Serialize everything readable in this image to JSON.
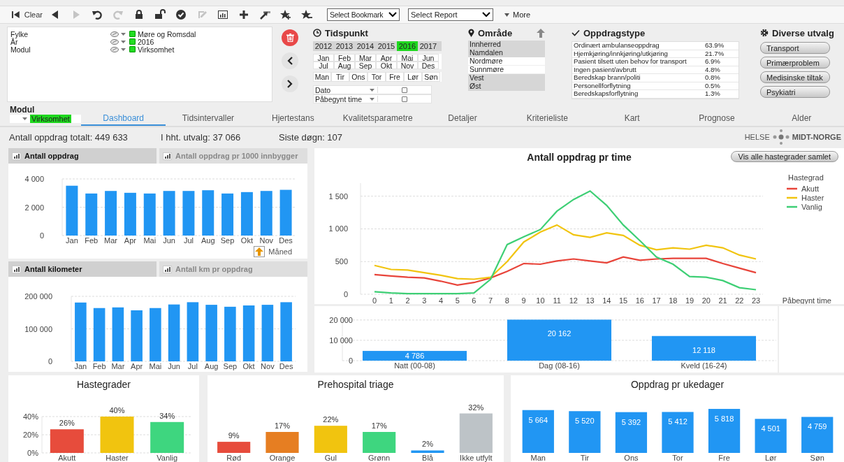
{
  "toolbar": {
    "items": [
      {
        "kind": "clear",
        "label": "Clear",
        "disabled": false
      },
      {
        "kind": "back",
        "disabled": false
      },
      {
        "kind": "forward",
        "disabled": true
      },
      {
        "kind": "undo",
        "disabled": false
      },
      {
        "kind": "redo",
        "disabled": true
      },
      {
        "kind": "lock",
        "disabled": false
      },
      {
        "kind": "unlock",
        "disabled": false
      },
      {
        "kind": "check",
        "disabled": false
      },
      {
        "kind": "edit",
        "disabled": true
      },
      {
        "kind": "chart",
        "disabled": false
      },
      {
        "kind": "add",
        "disabled": false
      },
      {
        "kind": "arrow",
        "disabled": false
      },
      {
        "kind": "star-add",
        "disabled": false
      },
      {
        "kind": "star-remove",
        "disabled": false
      }
    ],
    "bookmark_select": "Select Bookmark",
    "report_select": "Select Report",
    "more": "More"
  },
  "current_selections": [
    {
      "field": "Fylke",
      "value": "Møre og Romsdal",
      "selected": true
    },
    {
      "field": "År",
      "value": "2016",
      "selected": true
    },
    {
      "field": "Modul",
      "value": "Virksomhet",
      "selected": true
    }
  ],
  "tidspunkt": {
    "title": "Tidspunkt",
    "years": [
      {
        "label": "2012",
        "selected": false
      },
      {
        "label": "2013",
        "selected": false
      },
      {
        "label": "2014",
        "selected": false
      },
      {
        "label": "2015",
        "selected": false
      },
      {
        "label": "2016",
        "selected": true
      },
      {
        "label": "2017",
        "selected": false
      }
    ],
    "months": [
      {
        "label": "Jan",
        "selected": false
      },
      {
        "label": "Feb",
        "selected": false
      },
      {
        "label": "Mar",
        "selected": false
      },
      {
        "label": "Apr",
        "selected": false
      },
      {
        "label": "Mai",
        "selected": false
      },
      {
        "label": "Jun",
        "selected": false
      },
      {
        "label": "Jul",
        "selected": false
      },
      {
        "label": "Aug",
        "selected": false
      },
      {
        "label": "Sep",
        "selected": false
      },
      {
        "label": "Okt",
        "selected": false
      },
      {
        "label": "Nov",
        "selected": false
      },
      {
        "label": "Des",
        "selected": false
      }
    ],
    "weekdays": [
      {
        "label": "Man",
        "selected": false
      },
      {
        "label": "Tir",
        "selected": false
      },
      {
        "label": "Ons",
        "selected": false
      },
      {
        "label": "Tor",
        "selected": false
      },
      {
        "label": "Fre",
        "selected": false
      },
      {
        "label": "Lør",
        "selected": false
      },
      {
        "label": "Søn",
        "selected": false
      }
    ],
    "filters": [
      {
        "label": "Dato",
        "checked": false
      },
      {
        "label": "Påbegynt time",
        "checked": false
      }
    ]
  },
  "omrade": {
    "title": "Område",
    "items": [
      {
        "label": "Innherred",
        "excluded": true
      },
      {
        "label": "Namdalen",
        "excluded": true
      },
      {
        "label": "Nordmøre",
        "excluded": false
      },
      {
        "label": "Sunnmøre",
        "excluded": false
      },
      {
        "label": "Vest",
        "excluded": true
      },
      {
        "label": "Øst",
        "excluded": true
      }
    ]
  },
  "oppdragstype": {
    "title": "Oppdragstype",
    "rows": [
      {
        "label": "Ordinært ambulanseoppdrag",
        "share": "63.9%"
      },
      {
        "label": "Hjemkjøring/innkjøring/utkjøring",
        "share": "21.7%"
      },
      {
        "label": "Pasient tilsett uten behov for transport",
        "share": "6.9%"
      },
      {
        "label": "Ingen pasient/avbrutt",
        "share": "4.8%"
      },
      {
        "label": "Beredskap brann/politi",
        "share": "0.8%"
      },
      {
        "label": "Personellforflytning",
        "share": "0.5%"
      },
      {
        "label": "Beredskapsforflytning",
        "share": "1.3%"
      }
    ]
  },
  "diverse": {
    "title": "Diverse utvalg",
    "buttons": [
      "Transport",
      "Primærproblem",
      "Medisinske tiltak",
      "Psykiatri"
    ]
  },
  "modul": {
    "label": "Modul",
    "value": "Virksomhet",
    "selected": true
  },
  "tabs": [
    {
      "label": "Dashboard",
      "selected": true
    },
    {
      "label": "Tidsintervaller",
      "selected": false
    },
    {
      "label": "Hjertestans",
      "selected": false
    },
    {
      "label": "Kvalitetsparametre",
      "selected": false
    },
    {
      "label": "Detaljer",
      "selected": false
    },
    {
      "label": "Kriterieliste",
      "selected": false
    },
    {
      "label": "Kart",
      "selected": false
    },
    {
      "label": "Prognose",
      "selected": false
    },
    {
      "label": "Alder",
      "selected": false
    }
  ],
  "stats": [
    "Antall oppdrag totalt: 449 633",
    "I hht. utvalg: 37 066",
    "Siste døgn: 107"
  ],
  "logo": {
    "left": "HELSE",
    "right": "MIDT-NORGE"
  },
  "left_panels": [
    {
      "tabs": [
        {
          "label": "Antall oppdrag",
          "selected": true
        },
        {
          "label": "Antall oppdrag pr 1000 innbygger",
          "selected": false
        }
      ],
      "axis_button": "Måned",
      "chart_data": {
        "type": "bar",
        "grid": true,
        "categories": [
          "Jan",
          "Feb",
          "Mar",
          "Apr",
          "Mai",
          "Jun",
          "Jul",
          "Aug",
          "Sep",
          "Okt",
          "Nov",
          "Des"
        ],
        "series": [
          {
            "color": "#2196f3",
            "values": [
              3520,
              2970,
              3150,
              3020,
              2970,
              3150,
              3150,
              3200,
              2970,
              3070,
              3150,
              3230
            ]
          }
        ],
        "ylim": [
          0,
          4000
        ],
        "yticks": [
          0,
          {
            "value": 2000,
            "label": "2 000"
          },
          {
            "value": 4000,
            "label": "4 000"
          }
        ]
      }
    },
    {
      "tabs": [
        {
          "label": "Antall kilometer",
          "selected": true
        },
        {
          "label": "Antall km pr oppdrag",
          "selected": false
        }
      ],
      "chart_data": {
        "type": "bar",
        "grid": true,
        "categories": [
          "Jan",
          "Feb",
          "Mar",
          "Apr",
          "Mai",
          "Jun",
          "Jul",
          "Aug",
          "Sep",
          "Okt",
          "Nov",
          "Des"
        ],
        "series": [
          {
            "color": "#2196f3",
            "values": [
              181000,
              164000,
              166000,
              157000,
              164000,
              175000,
              182000,
              174000,
              168000,
              172000,
              174000,
              182000
            ]
          }
        ],
        "ylim": [
          0,
          200000
        ],
        "yticks": [
          0,
          {
            "value": 100000,
            "label": "100 000"
          },
          {
            "value": 200000,
            "label": "200 000"
          }
        ]
      }
    }
  ],
  "hourly": {
    "button": "Vis alle hastegrader samlet",
    "legend_title": "Hastegrad",
    "chart_data": {
      "type": "line",
      "grid": true,
      "legend": "right",
      "ylim": [
        0,
        1700
      ],
      "title": "Antall oppdrag pr time",
      "xlabel": "Påbegynt time",
      "x": [
        0,
        1,
        2,
        3,
        4,
        5,
        6,
        7,
        8,
        9,
        10,
        11,
        12,
        13,
        14,
        15,
        16,
        17,
        18,
        19,
        20,
        21,
        22,
        23
      ],
      "yticks": [
        0,
        500,
        {
          "value": 1000,
          "label": "1 000"
        },
        {
          "value": 1500,
          "label": "1 500"
        }
      ],
      "series": [
        {
          "name": "Akutt",
          "color": "#e8443a",
          "values": [
            300,
            280,
            260,
            250,
            200,
            140,
            180,
            250,
            350,
            470,
            460,
            510,
            540,
            510,
            480,
            570,
            520,
            540,
            550,
            550,
            550,
            470,
            400,
            330
          ]
        },
        {
          "name": "Haster",
          "color": "#f1c40f",
          "values": [
            440,
            380,
            370,
            330,
            290,
            240,
            230,
            260,
            500,
            800,
            950,
            1060,
            910,
            870,
            940,
            900,
            750,
            680,
            710,
            690,
            750,
            710,
            600,
            540
          ]
        },
        {
          "name": "Vanlig",
          "color": "#3ecf75",
          "values": [
            40,
            20,
            10,
            10,
            10,
            10,
            20,
            230,
            760,
            880,
            990,
            1270,
            1450,
            1580,
            1360,
            1060,
            820,
            570,
            460,
            270,
            260,
            210,
            100,
            70
          ]
        }
      ]
    }
  },
  "shifts": {
    "chart_data": {
      "type": "bar",
      "grid": true,
      "ylim": [
        0,
        22000
      ],
      "categories": [
        "Natt (00-08)",
        "Dag (08-16)",
        "Kveld (16-24)"
      ],
      "series": [
        {
          "color": "#2196f3",
          "values": [
            4786,
            20162,
            12118
          ]
        }
      ],
      "yticks": [
        0,
        {
          "value": 10000,
          "label": "10 000"
        },
        {
          "value": 20000,
          "label": "20 000"
        }
      ],
      "value_labels": [
        "4 786",
        "20 162",
        "12 118"
      ]
    }
  },
  "bottom_panels": [
    {
      "chart_data": {
        "type": "bar",
        "grid": true,
        "ylim": [
          0,
          40
        ],
        "title": "Hastegrader",
        "categories": [
          "Akutt",
          "Haster",
          "Vanlig"
        ],
        "values": [
          26,
          40,
          34
        ],
        "colors": [
          "#e74c3c",
          "#f1c40f",
          "#3ed67f"
        ],
        "yticks": [
          {
            "value": 0,
            "label": "0%"
          },
          {
            "value": 20,
            "label": "20%"
          },
          {
            "value": 40,
            "label": "40%"
          }
        ],
        "value_labels": [
          "26%",
          "40%",
          "34%"
        ]
      }
    },
    {
      "chart_data": {
        "type": "bar",
        "title": "Prehospital triage",
        "categories": [
          "Rød",
          "Orange",
          "Gul",
          "Grønn",
          "Blå",
          "Ikke utfylt"
        ],
        "values": [
          9,
          17,
          22,
          17,
          2,
          32
        ],
        "colors": [
          "#e74c3c",
          "#e67e22",
          "#f1c40f",
          "#3ed67f",
          "#2196f3",
          "#bdc3c7"
        ],
        "value_labels": [
          "9%",
          "17%",
          "22%",
          "17%",
          "2%",
          "32%"
        ]
      }
    },
    {
      "chart_data": {
        "type": "bar",
        "data_labels": true,
        "title": "Oppdrag pr ukedager",
        "categories": [
          "Man",
          "Tir",
          "Ons",
          "Tor",
          "Fre",
          "Lør",
          "Søn"
        ],
        "series": [
          {
            "color": "#2196f3",
            "values": [
              5664,
              5520,
              5392,
              5412,
              5818,
              4501,
              4759
            ]
          }
        ],
        "value_labels": [
          "5 664",
          "5 520",
          "5 392",
          "5 412",
          "5 818",
          "4 501",
          "4 759"
        ]
      }
    }
  ]
}
